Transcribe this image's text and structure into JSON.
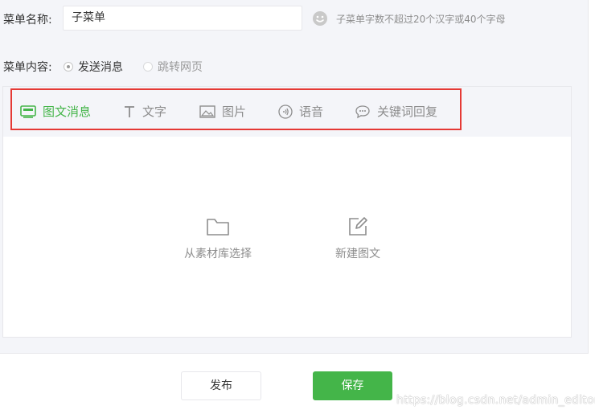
{
  "menu_name": {
    "label": "菜单名称:",
    "value": "子菜单",
    "hint": "子菜单字数不超过20个汉字或40个字母",
    "emoji_icon": "smiley-icon"
  },
  "menu_content": {
    "label": "菜单内容:",
    "options": [
      {
        "label": "发送消息",
        "selected": true
      },
      {
        "label": "跳转网页",
        "selected": false
      }
    ]
  },
  "tabs": [
    {
      "label": "图文消息",
      "icon": "news-icon",
      "active": true
    },
    {
      "label": "文字",
      "icon": "text-icon",
      "active": false
    },
    {
      "label": "图片",
      "icon": "image-icon",
      "active": false
    },
    {
      "label": "语音",
      "icon": "voice-icon",
      "active": false
    },
    {
      "label": "关键词回复",
      "icon": "chat-icon",
      "active": false
    }
  ],
  "actions": {
    "from_library": "从素材库选择",
    "create_news": "新建图文"
  },
  "buttons": {
    "publish": "发布",
    "save": "保存"
  },
  "watermark": "https://blog.csdn.net/admin_editor",
  "colors": {
    "accent_green": "#44b549",
    "highlight_red": "#e53935",
    "panel_bg": "#f4f5f9"
  }
}
